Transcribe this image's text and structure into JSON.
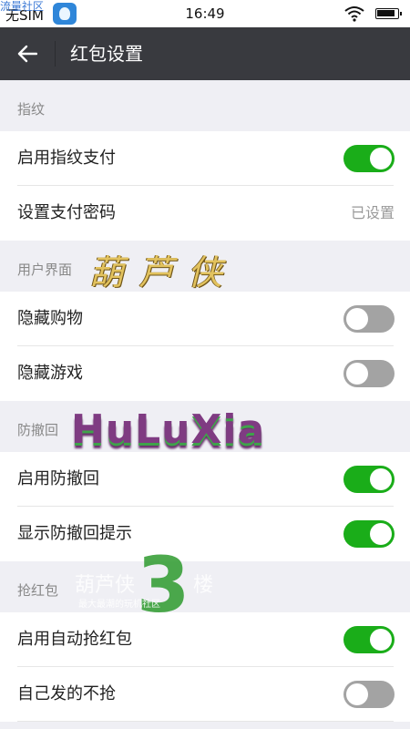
{
  "status_bar": {
    "carrier": "无SIM",
    "watermark": "流量社区",
    "time": "16:49",
    "app_icon": "huluxia-app-icon",
    "wifi_icon": "wifi-icon",
    "battery_icon": "battery-icon"
  },
  "app_bar": {
    "title": "红包设置",
    "back_icon": "back-arrow-icon",
    "background": "#393a3f"
  },
  "sections": [
    {
      "header": "指纹",
      "rows": [
        {
          "label": "启用指纹支付",
          "toggle": true
        },
        {
          "label": "设置支付密码",
          "value": "已设置"
        }
      ]
    },
    {
      "header": "用户界面",
      "rows": [
        {
          "label": "隐藏购物",
          "toggle": false
        },
        {
          "label": "隐藏游戏",
          "toggle": false
        }
      ]
    },
    {
      "header": "防撤回",
      "rows": [
        {
          "label": "启用防撤回",
          "toggle": true
        },
        {
          "label": "显示防撤回提示",
          "toggle": true
        }
      ]
    },
    {
      "header": "抢红包",
      "rows": [
        {
          "label": "启用自动抢红包",
          "toggle": true
        },
        {
          "label": "自己发的不抢",
          "toggle": false
        }
      ]
    }
  ],
  "watermarks": {
    "gourd_title": "葫芦侠",
    "huluxia": "HuLuXia",
    "brand": "葫芦侠",
    "number": "3",
    "floor": "楼",
    "tagline": "最大最潮的玩机社区"
  },
  "colors": {
    "toggle_on": "#1aad19",
    "toggle_off": "#a3a3a3",
    "page_background": "#efeff4"
  }
}
